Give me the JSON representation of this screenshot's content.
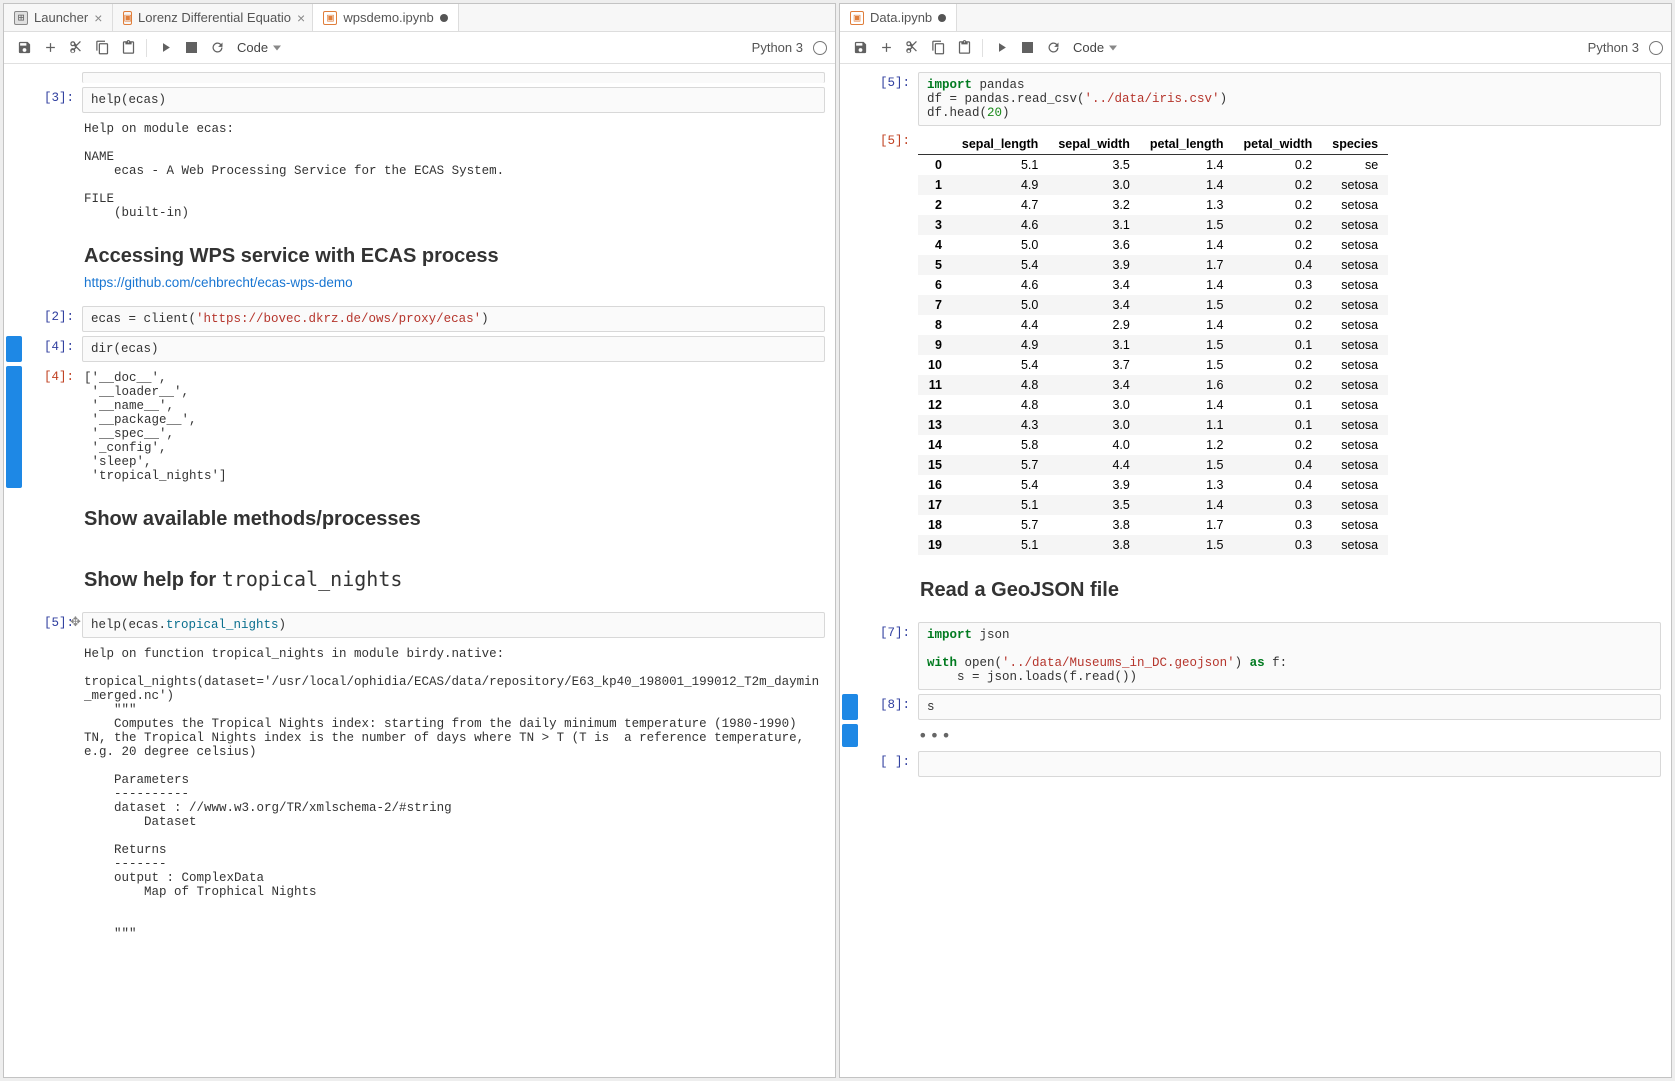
{
  "left": {
    "tabs": [
      {
        "label": "Launcher",
        "icon": "launcher",
        "active": false,
        "close": true
      },
      {
        "label": "Lorenz Differential Equatio",
        "icon": "nb",
        "active": false,
        "close": true
      },
      {
        "label": "wpsdemo.ipynb",
        "icon": "nb",
        "active": true,
        "dirty": true
      }
    ],
    "toolbar": {
      "celltype": "Code",
      "kernel": "Python 3"
    },
    "cells": {
      "c3_prompt": "[3]:",
      "c3_code": "help(ecas)",
      "c3_out": "Help on module ecas:\n\nNAME\n    ecas - A Web Processing Service for the ECAS System.\n\nFILE\n    (built-in)\n",
      "h1": "Accessing WPS service with ECAS process",
      "link": "https://github.com/cehbrecht/ecas-wps-demo",
      "c2_prompt": "[2]:",
      "c2_code_pre": "ecas = client(",
      "c2_code_str": "'https://bovec.dkrz.de/ows/proxy/ecas'",
      "c2_code_post": ")",
      "c4_prompt": "[4]:",
      "c4_code": "dir(ecas)",
      "c4o_prompt": "[4]:",
      "c4_out": "['__doc__',\n '__loader__',\n '__name__',\n '__package__',\n '__spec__',\n '_config',\n 'sleep',\n 'tropical_nights']",
      "h2": "Show available methods/processes",
      "h3a": "Show help for ",
      "h3b": "tropical_nights",
      "c5_prompt": "[5]:",
      "c5_code_pre": "help(ecas.",
      "c5_code_attr": "tropical_nights",
      "c5_code_post": ")",
      "c5_out": "Help on function tropical_nights in module birdy.native:\n\ntropical_nights(dataset='/usr/local/ophidia/ECAS/data/repository/E63_kp40_198001_199012_T2m_daymin_merged.nc')\n    \"\"\"\n    Computes the Tropical Nights index: starting from the daily minimum temperature (1980-1990) TN, the Tropical Nights index is the number of days where TN > T (T is  a reference temperature, e.g. 20 degree celsius)\n    \n    Parameters\n    ----------\n    dataset : //www.w3.org/TR/xmlschema-2/#string\n        Dataset\n    \n    Returns\n    -------\n    output : ComplexData\n        Map of Trophical Nights\n    \n    \n    \"\"\""
    }
  },
  "right": {
    "tabs": [
      {
        "label": "Data.ipynb",
        "icon": "nb",
        "active": true,
        "dirty": true
      }
    ],
    "toolbar": {
      "celltype": "Code",
      "kernel": "Python 3"
    },
    "cells": {
      "c5_prompt": "[5]:",
      "c5_code_l1_kw": "import",
      "c5_code_l1_mod": " pandas",
      "c5_code_l2a": "df = pandas.read_csv(",
      "c5_code_l2s": "'../data/iris.csv'",
      "c5_code_l2b": ")",
      "c5_code_l3a": "df.head(",
      "c5_code_l3n": "20",
      "c5_code_l3b": ")",
      "df_prompt": "[5]:",
      "df_headers": [
        "",
        "sepal_length",
        "sepal_width",
        "petal_length",
        "petal_width",
        "species"
      ],
      "df_rows": [
        [
          "0",
          "5.1",
          "3.5",
          "1.4",
          "0.2",
          "se"
        ],
        [
          "1",
          "4.9",
          "3.0",
          "1.4",
          "0.2",
          "setosa"
        ],
        [
          "2",
          "4.7",
          "3.2",
          "1.3",
          "0.2",
          "setosa"
        ],
        [
          "3",
          "4.6",
          "3.1",
          "1.5",
          "0.2",
          "setosa"
        ],
        [
          "4",
          "5.0",
          "3.6",
          "1.4",
          "0.2",
          "setosa"
        ],
        [
          "5",
          "5.4",
          "3.9",
          "1.7",
          "0.4",
          "setosa"
        ],
        [
          "6",
          "4.6",
          "3.4",
          "1.4",
          "0.3",
          "setosa"
        ],
        [
          "7",
          "5.0",
          "3.4",
          "1.5",
          "0.2",
          "setosa"
        ],
        [
          "8",
          "4.4",
          "2.9",
          "1.4",
          "0.2",
          "setosa"
        ],
        [
          "9",
          "4.9",
          "3.1",
          "1.5",
          "0.1",
          "setosa"
        ],
        [
          "10",
          "5.4",
          "3.7",
          "1.5",
          "0.2",
          "setosa"
        ],
        [
          "11",
          "4.8",
          "3.4",
          "1.6",
          "0.2",
          "setosa"
        ],
        [
          "12",
          "4.8",
          "3.0",
          "1.4",
          "0.1",
          "setosa"
        ],
        [
          "13",
          "4.3",
          "3.0",
          "1.1",
          "0.1",
          "setosa"
        ],
        [
          "14",
          "5.8",
          "4.0",
          "1.2",
          "0.2",
          "setosa"
        ],
        [
          "15",
          "5.7",
          "4.4",
          "1.5",
          "0.4",
          "setosa"
        ],
        [
          "16",
          "5.4",
          "3.9",
          "1.3",
          "0.4",
          "setosa"
        ],
        [
          "17",
          "5.1",
          "3.5",
          "1.4",
          "0.3",
          "setosa"
        ],
        [
          "18",
          "5.7",
          "3.8",
          "1.7",
          "0.3",
          "setosa"
        ],
        [
          "19",
          "5.1",
          "3.8",
          "1.5",
          "0.3",
          "setosa"
        ]
      ],
      "h1": "Read a GeoJSON file",
      "c7_prompt": "[7]:",
      "c7_l1_kw": "import",
      "c7_l1_mod": " json",
      "c7_l2_kw1": "with",
      "c7_l2_fn": " open(",
      "c7_l2_s": "'../data/Museums_in_DC.geojson'",
      "c7_l2_post": ") ",
      "c7_l2_kw2": "as",
      "c7_l2_var": " f:",
      "c7_l3": "    s = json.loads(f.read())",
      "c8_prompt": "[8]:",
      "c8_code": "s",
      "c8_ellipsis": "•••",
      "cE_prompt": "[ ]:"
    }
  },
  "chart_data": {
    "type": "table",
    "title": "iris head(20)",
    "columns": [
      "sepal_length",
      "sepal_width",
      "petal_length",
      "petal_width",
      "species"
    ],
    "rows": [
      [
        5.1,
        3.5,
        1.4,
        0.2,
        "se"
      ],
      [
        4.9,
        3.0,
        1.4,
        0.2,
        "setosa"
      ],
      [
        4.7,
        3.2,
        1.3,
        0.2,
        "setosa"
      ],
      [
        4.6,
        3.1,
        1.5,
        0.2,
        "setosa"
      ],
      [
        5.0,
        3.6,
        1.4,
        0.2,
        "setosa"
      ],
      [
        5.4,
        3.9,
        1.7,
        0.4,
        "setosa"
      ],
      [
        4.6,
        3.4,
        1.4,
        0.3,
        "setosa"
      ],
      [
        5.0,
        3.4,
        1.5,
        0.2,
        "setosa"
      ],
      [
        4.4,
        2.9,
        1.4,
        0.2,
        "setosa"
      ],
      [
        4.9,
        3.1,
        1.5,
        0.1,
        "setosa"
      ],
      [
        5.4,
        3.7,
        1.5,
        0.2,
        "setosa"
      ],
      [
        4.8,
        3.4,
        1.6,
        0.2,
        "setosa"
      ],
      [
        4.8,
        3.0,
        1.4,
        0.1,
        "setosa"
      ],
      [
        4.3,
        3.0,
        1.1,
        0.1,
        "setosa"
      ],
      [
        5.8,
        4.0,
        1.2,
        0.2,
        "setosa"
      ],
      [
        5.7,
        4.4,
        1.5,
        0.4,
        "setosa"
      ],
      [
        5.4,
        3.9,
        1.3,
        0.4,
        "setosa"
      ],
      [
        5.1,
        3.5,
        1.4,
        0.3,
        "setosa"
      ],
      [
        5.7,
        3.8,
        1.7,
        0.3,
        "setosa"
      ],
      [
        5.1,
        3.8,
        1.5,
        0.3,
        "setosa"
      ]
    ]
  }
}
